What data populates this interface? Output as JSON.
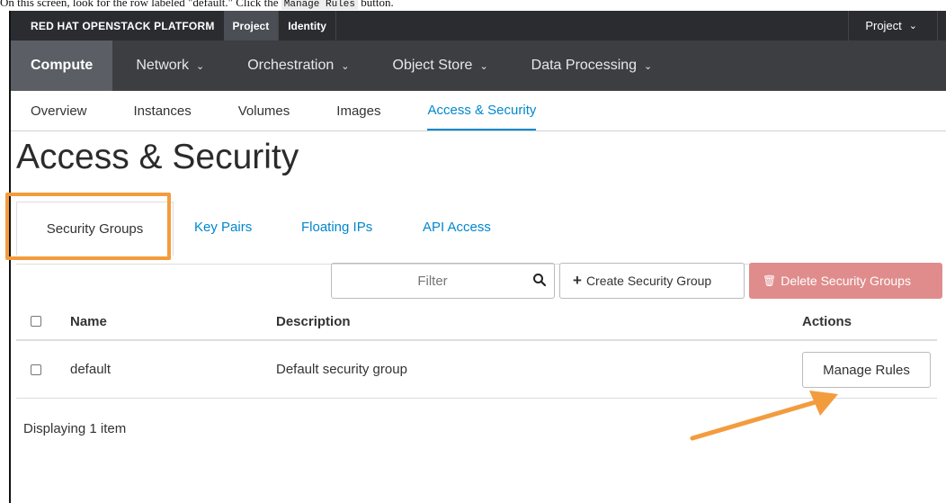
{
  "caption": {
    "pre": "On this screen, look for the row labeled \"default.\" Click the",
    "code": "Manage Rules",
    "post": "button."
  },
  "topbar": {
    "brand": "RED HAT OPENSTACK PLATFORM",
    "tabs": [
      "Project",
      "Identity"
    ],
    "right": "Project"
  },
  "navbar": {
    "items": [
      "Compute",
      "Network",
      "Orchestration",
      "Object Store",
      "Data Processing"
    ]
  },
  "subnav": {
    "items": [
      "Overview",
      "Instances",
      "Volumes",
      "Images",
      "Access & Security"
    ]
  },
  "page_title": "Access & Security",
  "tabs": [
    "Security Groups",
    "Key Pairs",
    "Floating IPs",
    "API Access"
  ],
  "toolbar": {
    "filter_placeholder": "Filter",
    "create_label": "Create Security Group",
    "delete_label": "Delete Security Groups"
  },
  "table": {
    "headers": [
      "Name",
      "Description",
      "Actions"
    ],
    "rows": [
      {
        "name": "default",
        "description": "Default security group",
        "action": "Manage Rules"
      }
    ]
  },
  "footer": "Displaying 1 item",
  "colors": {
    "accent": "#0088ce",
    "highlight": "#f39c3e",
    "danger": "#e08c8c"
  }
}
